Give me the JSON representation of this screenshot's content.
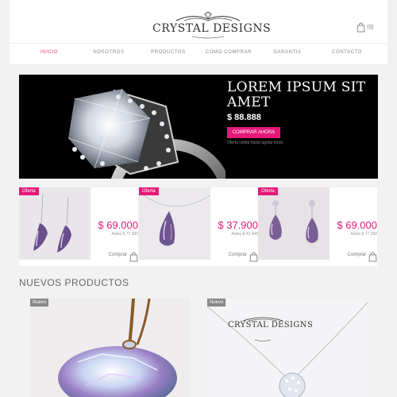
{
  "header": {
    "logo_text": "CRYSTAL DESIGNS",
    "cart_count": "(0)"
  },
  "nav": {
    "items": [
      {
        "label": "INICIO",
        "active": true
      },
      {
        "label": "NOSOTROS",
        "active": false
      },
      {
        "label": "PRODUCTOS",
        "active": false
      },
      {
        "label": "COMO COMPRAR",
        "active": false
      },
      {
        "label": "GARANTIA",
        "active": false
      },
      {
        "label": "CONTACTO",
        "active": false
      }
    ]
  },
  "hero": {
    "title": "LOREM IPSUM SIT AMET",
    "price": "$ 88.888",
    "button_label": "COMPRAR AHORA",
    "note": "Oferta válida hasta agotar stock."
  },
  "offers": [
    {
      "badge": "Oferta",
      "price": "$ 69.000",
      "before": "Antes $ 77.280",
      "buy_label": "Comprar"
    },
    {
      "badge": "Oferta",
      "price": "$ 37.900",
      "before": "Antes $ 42.448",
      "buy_label": "Comprar"
    },
    {
      "badge": "Oferta",
      "price": "$ 69.000",
      "before": "Antes $ 77.280",
      "buy_label": "Comprar"
    }
  ],
  "section": {
    "title": "NUEVOS PRODUCTOS"
  },
  "products": [
    {
      "badge": "Nuevo"
    },
    {
      "badge": "Nuevo",
      "watermark": "CRYSTAL DESIGNS"
    }
  ],
  "colors": {
    "accent": "#e5197a",
    "nav_active": "#e5447e",
    "hero_bg": "#000000"
  }
}
